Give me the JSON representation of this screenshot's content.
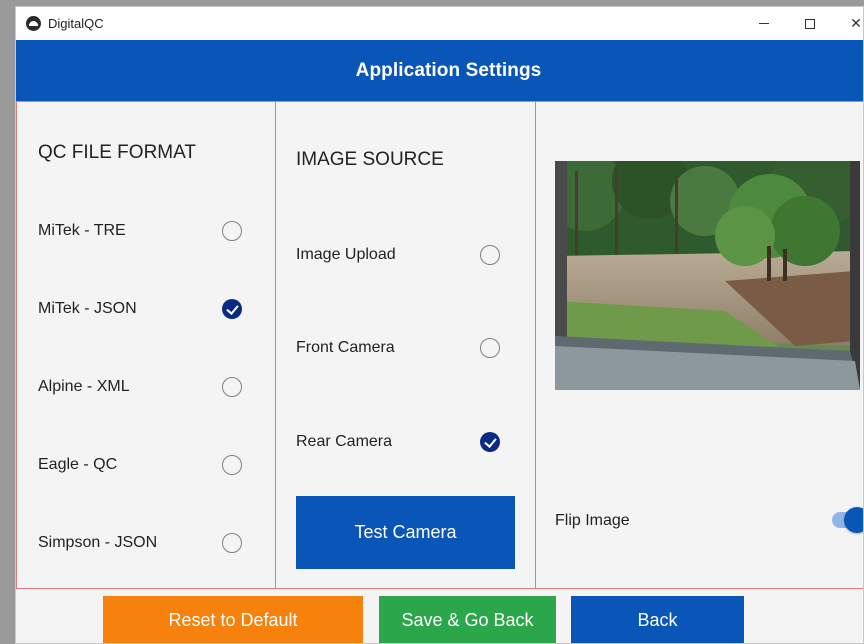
{
  "window": {
    "title": "DigitalQC",
    "minimize_glyph": "",
    "maximize_glyph": "",
    "close_glyph": "✕"
  },
  "header": {
    "title": "Application Settings"
  },
  "qc_file_format": {
    "title": "QC FILE FORMAT",
    "options": [
      {
        "label": "MiTek - TRE",
        "selected": false
      },
      {
        "label": "MiTek - JSON",
        "selected": true
      },
      {
        "label": "Alpine - XML",
        "selected": false
      },
      {
        "label": "Eagle - QC",
        "selected": false
      },
      {
        "label": "Simpson - JSON",
        "selected": false
      }
    ]
  },
  "image_source": {
    "title": "IMAGE SOURCE",
    "options": [
      {
        "label": "Image Upload",
        "selected": false
      },
      {
        "label": "Front Camera",
        "selected": false
      },
      {
        "label": "Rear Camera",
        "selected": true
      }
    ],
    "test_button": "Test Camera"
  },
  "preview": {
    "flip_label": "Flip Image",
    "flip_enabled": true
  },
  "footer": {
    "reset_label": "Reset to Default",
    "save_label": "Save & Go Back",
    "back_label": "Back"
  },
  "colors": {
    "primary": "#0a56b8",
    "checked": "#0a2a85",
    "reset": "#f6820d",
    "save": "#2ba64a",
    "panel_border": "#e27b7b"
  }
}
